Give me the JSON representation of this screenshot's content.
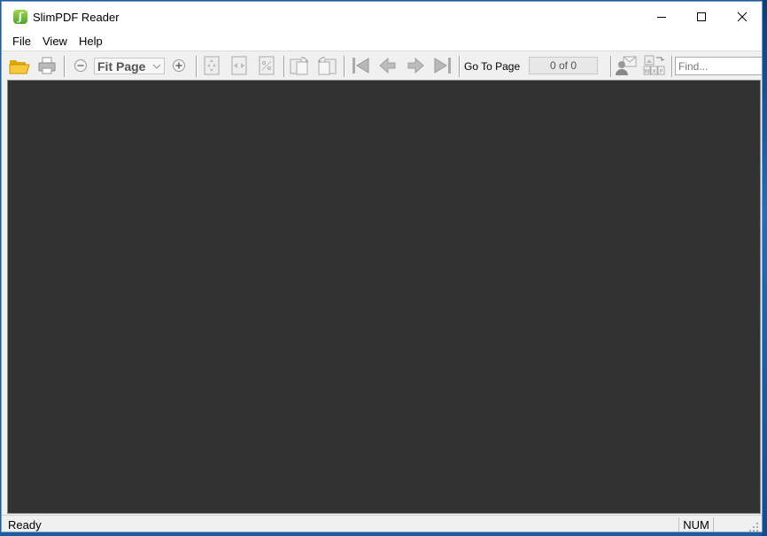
{
  "window": {
    "title": "SlimPDF Reader",
    "app_icon_glyph": "ʃ",
    "accent": "#5cb531"
  },
  "menu": {
    "items": [
      {
        "label": "File"
      },
      {
        "label": "View"
      },
      {
        "label": "Help"
      }
    ]
  },
  "toolbar": {
    "zoom_value": "Fit Page",
    "goto_label": "Go To Page",
    "page_indicator": "0 of 0",
    "find_placeholder": "Find..."
  },
  "status": {
    "text": "Ready",
    "num": "NUM"
  },
  "colors": {
    "viewer_bg": "#323232",
    "toolbar_bg": "#f0f0f0"
  }
}
